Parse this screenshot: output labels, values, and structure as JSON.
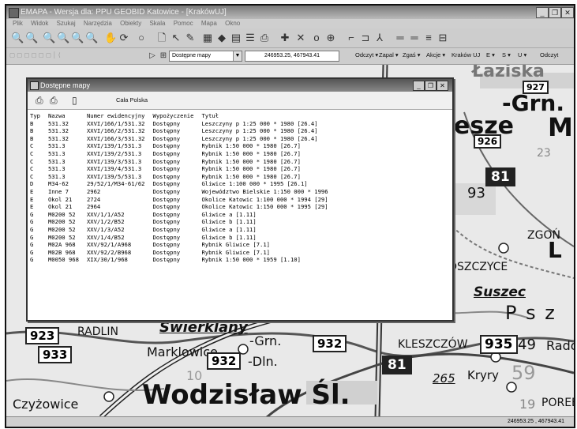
{
  "app": {
    "title": "EMAPA - Wersja dla: PPU GEOBID Katowice - [KrakówUJ]",
    "menu": [
      "Plik",
      "Widok",
      "Szukaj",
      "Narzędzia",
      "Obiekty",
      "Skala",
      "Pomoc",
      "Mapa",
      "Okno"
    ],
    "window_controls": [
      "_",
      "❐",
      "✕"
    ]
  },
  "toolbar2": {
    "map_select": "Dostępne mapy",
    "coordinates": "246953.25, 467943.41",
    "buttons": [
      "Odczyt ▾",
      "Zapal ▾",
      "Zgaś ▾",
      "Akcje ▾",
      "Kraków UJ",
      "E ▾",
      "S ▾",
      "U ▾",
      "Odczyt"
    ]
  },
  "dialog": {
    "title": "Dostępne mapy",
    "region": "Cała Polska",
    "columns": [
      "Typ",
      "Nazwa",
      "Numer ewidencyjny",
      "Wypożyczenie",
      "Tytuł"
    ],
    "rows": [
      [
        "B",
        "531.32",
        "XXVI/166/1/531.32",
        "Dostępny",
        "Leszczyny p 1:25 000 * 1980  [26.4]"
      ],
      [
        "B",
        "531.32",
        "XXVI/166/2/531.32",
        "Dostępny",
        "Leszczyny p 1:25 000 * 1980  [26.4]"
      ],
      [
        "B",
        "531.32",
        "XXVI/166/3/531.32",
        "Dostępny",
        "Leszczyny p 1:25 000 * 1980  [26.4]"
      ],
      [
        "C",
        "531.3",
        "XXVI/139/1/531.3",
        "Dostępny",
        "Rybnik 1:50 000 * 1980  [26.7]"
      ],
      [
        "C",
        "531.3",
        "XXVI/139/2/531.3",
        "Dostępny",
        "Rybnik 1:50 000 * 1980  [26.7]"
      ],
      [
        "C",
        "531.3",
        "XXVI/139/3/531.3",
        "Dostępny",
        "Rybnik 1:50 000 * 1980  [26.7]"
      ],
      [
        "C",
        "531.3",
        "XXVI/139/4/531.3",
        "Dostępny",
        "Rybnik 1:50 000 * 1980  [26.7]"
      ],
      [
        "C",
        "531.3",
        "XXVI/139/5/531.3",
        "Dostępny",
        "Rybnik 1:50 000 * 1980  [26.7]"
      ],
      [
        "D",
        "M34-62",
        "29/52/1/M34-61/62",
        "Dostępny",
        "Gliwice 1:100 000 * 1995  [26.1]"
      ],
      [
        "E",
        "Inne 7",
        "2962",
        "Dostępny",
        "Województwo Bielskie 1:150 000 * 1996"
      ],
      [
        "E",
        "Okol 21",
        "2724",
        "Dostępny",
        "Okolice Katowic 1:100 000 * 1994  [29]"
      ],
      [
        "E",
        "Okol 21",
        "2964",
        "Dostępny",
        "Okolice Katowic 1:150 000 * 1995  [29]"
      ],
      [
        "G",
        "M0200 52",
        "XXV/1/1/A52",
        "Dostępny",
        "Gliwice a [1.11]"
      ],
      [
        "G",
        "M0200 52",
        "XXV/1/2/B52",
        "Dostępny",
        "Gliwice b [1.11]"
      ],
      [
        "G",
        "M0200 52",
        "XXV/1/3/A52",
        "Dostępny",
        "Gliwice a [1.11]"
      ],
      [
        "G",
        "M0200 52",
        "XXV/1/4/B52",
        "Dostępny",
        "Gliwice b [1.11]"
      ],
      [
        "G",
        "M02A 968",
        "XXV/92/1/A968",
        "Dostępny",
        "Rybnik   Gliwice [7.1]"
      ],
      [
        "G",
        "M02B 968",
        "XXV/92/2/B968",
        "Dostępny",
        "Rybnik   Gliwice [7.1]"
      ],
      [
        "G",
        "M0050 968",
        "XIX/30/1/968",
        "Dostępny",
        "Rybnik 1:50 000 * 1959  [1.10]"
      ]
    ]
  },
  "map_labels": {
    "laziska": "Łaziska",
    "n927": "927",
    "grn_top": "-Grn.",
    "esze": "esze",
    "m_right": "M",
    "n926": "926",
    "n23": "23",
    "n81": "81",
    "n93": "93",
    "zgon": "ZGOŃ",
    "l_right": "L",
    "oszczyce": "OSZCZYCE",
    "suszec": "Suszec",
    "psz": "P s z",
    "n923": "923",
    "radlin": "RADLIN",
    "swierklany": "Świerklany",
    "grn_mid": "-Grn.",
    "n932a": "932",
    "kleszczow": "KLESZCZÓW",
    "n935": "935",
    "n49": "49",
    "rado": "Rado",
    "n933": "933",
    "marklowice": "Marklowice",
    "n932b": "932",
    "dln": "-Dln.",
    "n10": "10",
    "n81b": "81",
    "n265": "265",
    "kryry": "Kryry",
    "n59": "59",
    "czyzowice": "Czyżowice",
    "wodzislaw": "Wodzisław Śl.",
    "n19": "19",
    "poreb": "POREB"
  },
  "status": {
    "coordinates": "246953.25 , 467943.41"
  }
}
